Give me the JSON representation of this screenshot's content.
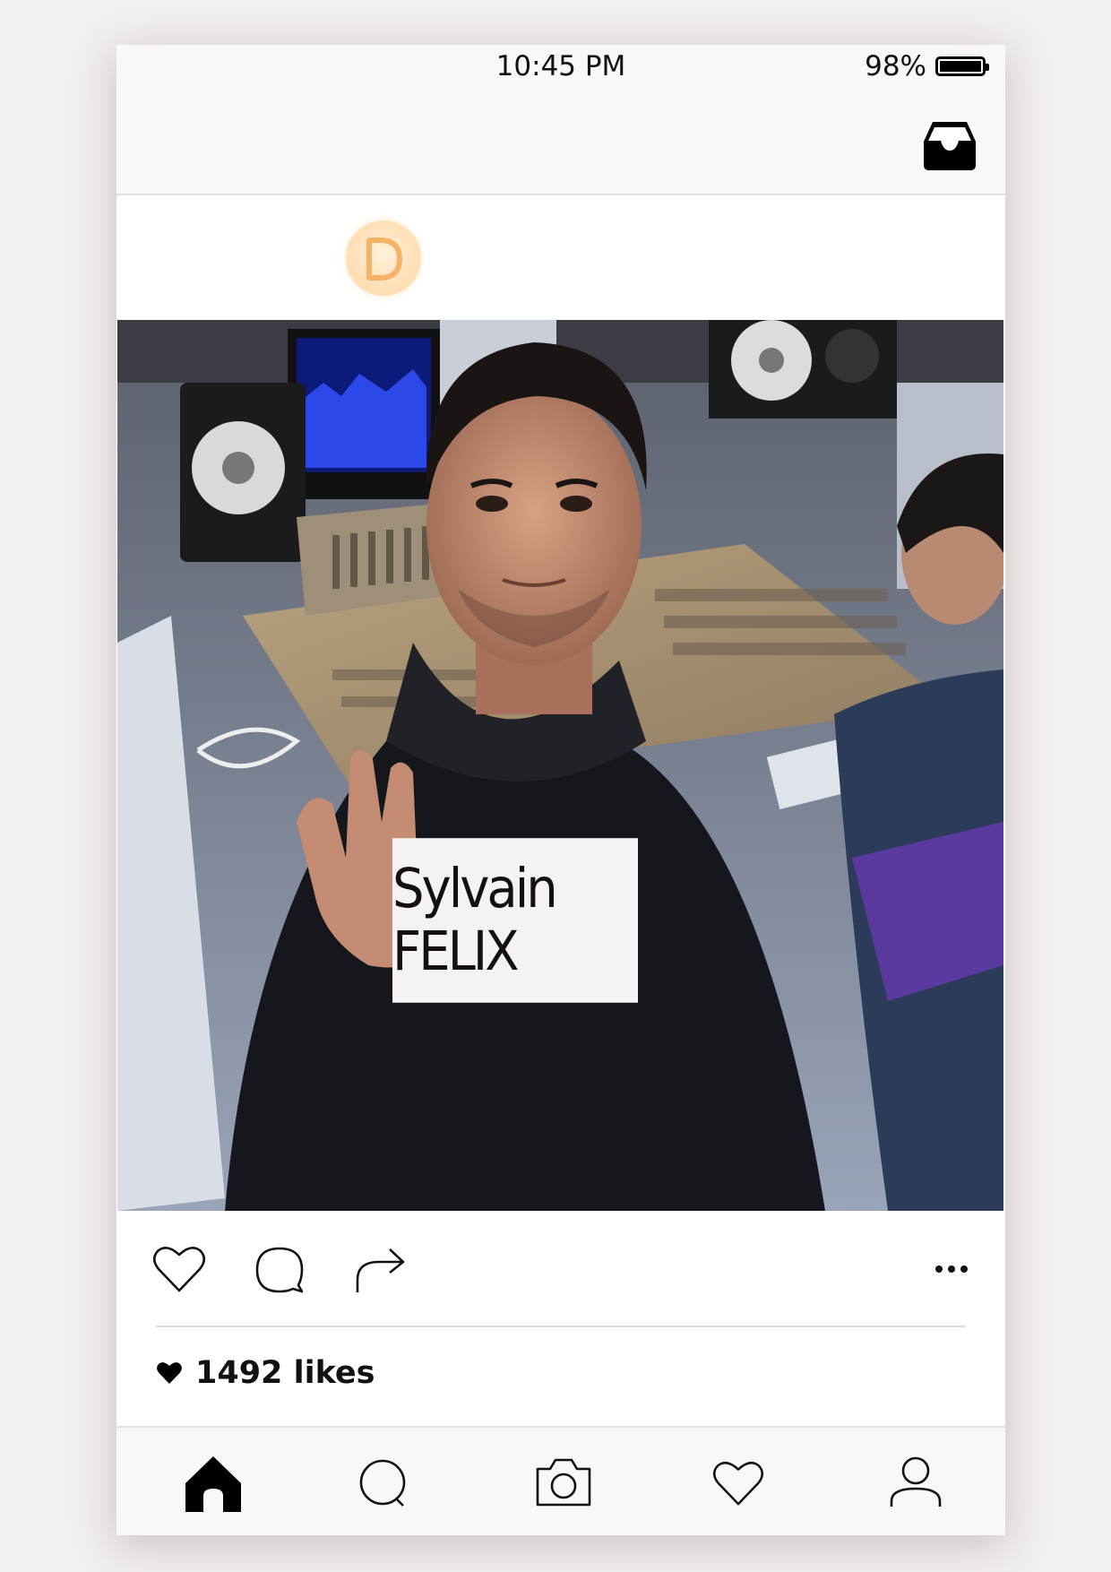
{
  "status_bar": {
    "time": "10:45 PM",
    "battery_percent": "98%",
    "battery_level": 0.98
  },
  "top_bar": {
    "icons": [
      "inbox-icon"
    ]
  },
  "post": {
    "avatar_letter": "D",
    "avatar_color": "#ffd9a8",
    "photo_card_text": "Sylvain FELIX",
    "likes_text": "1492 likes"
  },
  "actions": {
    "icons": [
      "heart-icon",
      "comment-icon",
      "share-icon",
      "more-icon"
    ]
  },
  "tab_bar": {
    "icons": [
      "home-icon",
      "search-icon",
      "camera-icon",
      "activity-heart-icon",
      "profile-icon"
    ],
    "active": "home-icon"
  }
}
